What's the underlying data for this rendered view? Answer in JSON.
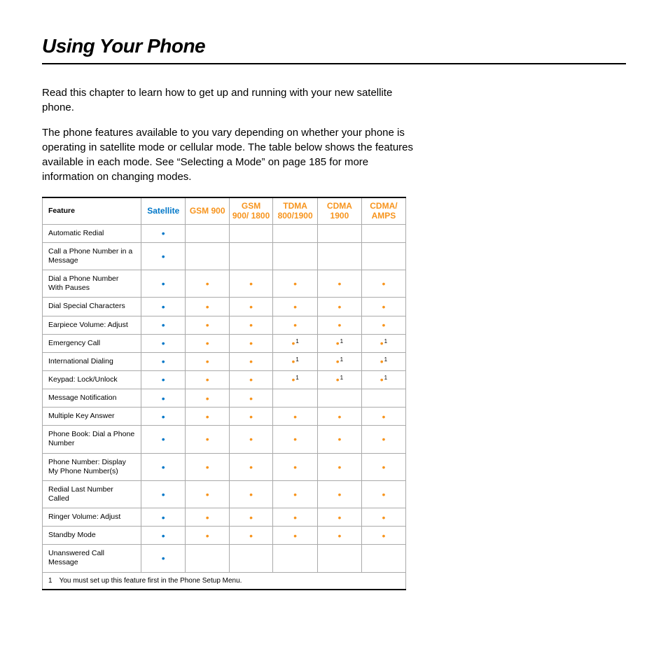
{
  "title": "Using Your Phone",
  "intro1": "Read this chapter to learn how to get up and running with your new satellite phone.",
  "intro2": "The phone features available to you vary depending on whether your phone is operating in satellite mode or cellular mode. The table below shows the features available in each mode. See “Selecting a Mode” on page 185 for more information on changing modes.",
  "headers": {
    "feature": "Feature",
    "sat": "Satellite",
    "gsm900": "GSM 900",
    "gsm900_1800": "GSM 900/ 1800",
    "tdma": "TDMA 800/1900",
    "cdma1900": "CDMA 1900",
    "cdma_amps": "CDMA/ AMPS"
  },
  "rows": [
    {
      "label": "Automatic Redial",
      "cells": [
        "b",
        "",
        "",
        "",
        "",
        ""
      ]
    },
    {
      "label": "Call a Phone Number in a Message",
      "cells": [
        "b",
        "",
        "",
        "",
        "",
        ""
      ]
    },
    {
      "label": "Dial a Phone Number With Pauses",
      "cells": [
        "b",
        "o",
        "o",
        "o",
        "o",
        "o"
      ]
    },
    {
      "label": "Dial Special Characters",
      "cells": [
        "b",
        "o",
        "o",
        "o",
        "o",
        "o"
      ]
    },
    {
      "label": "Earpiece Volume: Adjust",
      "cells": [
        "b",
        "o",
        "o",
        "o",
        "o",
        "o"
      ]
    },
    {
      "label": "Emergency Call",
      "cells": [
        "b",
        "o",
        "o",
        "o1",
        "o1",
        "o1"
      ]
    },
    {
      "label": "International Dialing",
      "cells": [
        "b",
        "o",
        "o",
        "o1",
        "o1",
        "o1"
      ]
    },
    {
      "label": "Keypad: Lock/Unlock",
      "cells": [
        "b",
        "o",
        "o",
        "o1",
        "o1",
        "o1"
      ]
    },
    {
      "label": "Message Notification",
      "cells": [
        "b",
        "o",
        "o",
        "",
        "",
        ""
      ]
    },
    {
      "label": "Multiple Key Answer",
      "cells": [
        "b",
        "o",
        "o",
        "o",
        "o",
        "o"
      ]
    },
    {
      "label": "Phone Book: Dial a Phone Number",
      "cells": [
        "b",
        "o",
        "o",
        "o",
        "o",
        "o"
      ]
    },
    {
      "label": "Phone Number: Display My Phone Number(s)",
      "cells": [
        "b",
        "o",
        "o",
        "o",
        "o",
        "o"
      ]
    },
    {
      "label": "Redial Last Number Called",
      "cells": [
        "b",
        "o",
        "o",
        "o",
        "o",
        "o"
      ]
    },
    {
      "label": "Ringer Volume: Adjust",
      "cells": [
        "b",
        "o",
        "o",
        "o",
        "o",
        "o"
      ]
    },
    {
      "label": "Standby Mode",
      "cells": [
        "b",
        "o",
        "o",
        "o",
        "o",
        "o"
      ]
    },
    {
      "label": "Unanswered Call Message",
      "cells": [
        "b",
        "",
        "",
        "",
        "",
        ""
      ]
    }
  ],
  "footnote": {
    "num": "1",
    "text": "You must set up this feature first in the Phone Setup Menu."
  }
}
